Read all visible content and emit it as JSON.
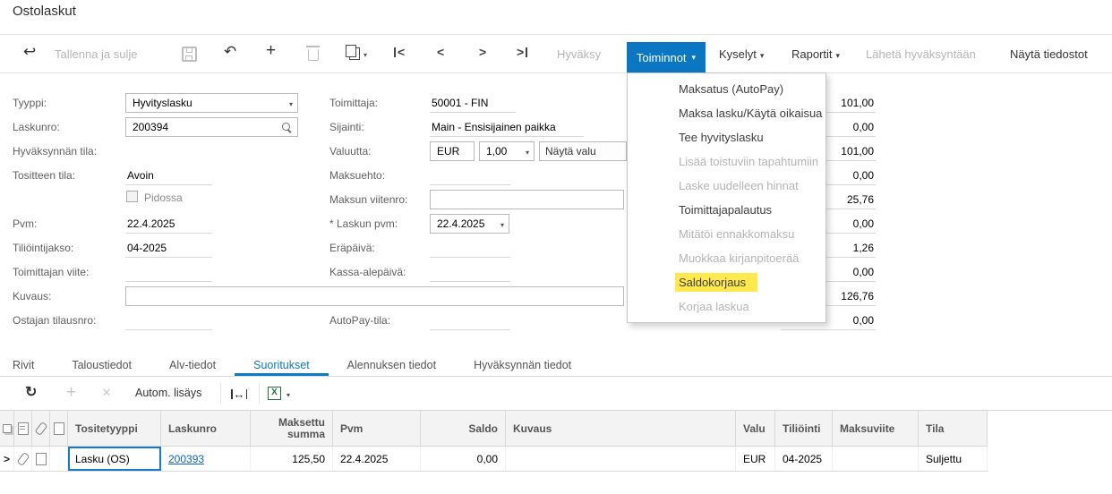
{
  "page": {
    "title": "Ostolaskut"
  },
  "icons": {
    "back": "↩",
    "undo": "↶",
    "plus": "+",
    "caret": "▾",
    "nav_first": "<",
    "nav_prev": "<",
    "nav_next": ">",
    "nav_last": ">",
    "refresh": "↻",
    "fit_width": "↔",
    "add": "+",
    "delete": "×",
    "excel": "X",
    "row_pointer": ">"
  },
  "colors": {
    "accent_blue": "#0b77c2",
    "highlight_yellow": "#ffe94d",
    "link_blue": "#0a63c2"
  },
  "toolbar": {
    "save_and_close": "Tallenna ja sulje",
    "approve": "Hyväksy",
    "actions": "Toiminnot",
    "inquiries": "Kyselyt",
    "reports": "Raportit",
    "send_to_approval": "Lähetä hyväksyntään",
    "show_files": "Näytä tiedostot"
  },
  "actions_menu": {
    "items": [
      {
        "label": "Maksatus (AutoPay)",
        "enabled": true,
        "highlighted": false
      },
      {
        "label": "Maksa lasku/Käytä oikaisua",
        "enabled": true,
        "highlighted": false
      },
      {
        "label": "Tee hyvityslasku",
        "enabled": true,
        "highlighted": false
      },
      {
        "label": "Lisää toistuviin tapahtumiin",
        "enabled": false,
        "highlighted": false
      },
      {
        "label": "Laske uudelleen hinnat",
        "enabled": false,
        "highlighted": false
      },
      {
        "label": "Toimittajapalautus",
        "enabled": true,
        "highlighted": false
      },
      {
        "label": "Mitätöi ennakkomaksu",
        "enabled": false,
        "highlighted": false
      },
      {
        "label": "Muokkaa kirjanpitoerää",
        "enabled": false,
        "highlighted": false
      },
      {
        "label": "Saldokorjaus",
        "enabled": true,
        "highlighted": true
      },
      {
        "label": "Korjaa laskua",
        "enabled": false,
        "highlighted": false
      }
    ]
  },
  "form": {
    "left": {
      "tyyppi_label": "Tyyppi:",
      "tyyppi_value": "Hyvityslasku",
      "laskunro_label": "Laskunro:",
      "laskunro_value": "200394",
      "hyvaksynnan_tila_label": "Hyväksynnän tila:",
      "hyvaksynnan_tila_value": "",
      "tositteen_tila_label": "Tositteen tila:",
      "tositteen_tila_value": "Avoin",
      "pidossa_label": "Pidossa",
      "pidossa_checked": false,
      "pvm_label": "Pvm:",
      "pvm_value": "22.4.2025",
      "tiliointijakso_label": "Tiliöintijakso:",
      "tiliointijakso_value": "04-2025",
      "toimittajan_viite_label": "Toimittajan viite:",
      "toimittajan_viite_value": "",
      "kuvaus_label": "Kuvaus:",
      "kuvaus_value": "",
      "ostajan_tilausnro_label": "Ostajan tilausnro:",
      "ostajan_tilausnro_value": ""
    },
    "middle": {
      "toimittaja_label": "Toimittaja:",
      "toimittaja_value": "50001 - FIN",
      "sijainti_label": "Sijainti:",
      "sijainti_value": "Main - Ensisijainen paikka",
      "valuutta_label": "Valuutta:",
      "valuutta_value": "EUR",
      "kurssi_value": "1,00",
      "nayta_valuutassa_button": "Näytä valu",
      "maksuehto_label": "Maksuehto:",
      "maksuehto_value": "",
      "maksun_viitenro_label": "Maksun viitenro:",
      "maksun_viitenro_value": "",
      "laskun_pvm_label": "* Laskun pvm:",
      "laskun_pvm_value": "22.4.2025",
      "erapaiva_label": "Eräpäivä:",
      "erapaiva_value": "",
      "kassa_alepaiva_label": "Kassa-alepäivä:",
      "kassa_alepaiva_value": "",
      "autopay_tila_label": "AutoPay-tila:",
      "autopay_tila_value": ""
    },
    "summary_amounts": [
      "101,00",
      "0,00",
      "101,00",
      "0,00",
      "25,76",
      "0,00",
      "1,26",
      "0,00",
      "126,76",
      "0,00"
    ]
  },
  "tabs": {
    "items": [
      "Rivit",
      "Taloustiedot",
      "Alv-tiedot",
      "Suoritukset",
      "Alennuksen tiedot",
      "Hyväksynnän tiedot"
    ],
    "active": "Suoritukset"
  },
  "grid": {
    "toolbar": {
      "auto_add_label": "Autom. lisäys"
    },
    "columns": {
      "tositetyyppi": "Tositetyyppi",
      "laskunro": "Laskunro",
      "maksettu_summa": "Maksettu summa",
      "pvm": "Pvm",
      "saldo": "Saldo",
      "kuvaus": "Kuvaus",
      "valuutta": "Valu",
      "tiliointi": "Tiliöinti",
      "maksuviite": "Maksuviite",
      "tila": "Tila"
    },
    "rows": [
      {
        "tositetyyppi": "Lasku (OS)",
        "laskunro": "200393",
        "maksettu_summa": "125,50",
        "pvm": "22.4.2025",
        "saldo": "0,00",
        "kuvaus": "",
        "valuutta": "EUR",
        "tiliointi": "04-2025",
        "maksuviite": "",
        "tila": "Suljettu"
      }
    ]
  }
}
